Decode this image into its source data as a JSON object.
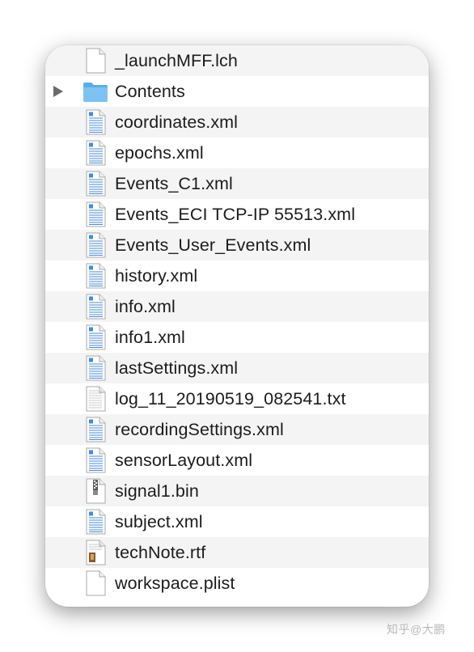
{
  "finder": {
    "files": [
      {
        "name": "_launchMFF.lch",
        "icon": "blank-document-icon",
        "kind": "blank"
      },
      {
        "name": "Contents",
        "icon": "folder-icon",
        "kind": "folder",
        "expandable": true
      },
      {
        "name": "coordinates.xml",
        "icon": "xml-document-icon",
        "kind": "xml"
      },
      {
        "name": "epochs.xml",
        "icon": "xml-document-icon",
        "kind": "xml"
      },
      {
        "name": "Events_C1.xml",
        "icon": "xml-document-icon",
        "kind": "xml"
      },
      {
        "name": "Events_ECI TCP-IP 55513.xml",
        "icon": "xml-document-icon",
        "kind": "xml"
      },
      {
        "name": "Events_User_Events.xml",
        "icon": "xml-document-icon",
        "kind": "xml"
      },
      {
        "name": "history.xml",
        "icon": "xml-document-icon",
        "kind": "xml"
      },
      {
        "name": "info.xml",
        "icon": "xml-document-icon",
        "kind": "xml"
      },
      {
        "name": "info1.xml",
        "icon": "xml-document-icon",
        "kind": "xml"
      },
      {
        "name": "lastSettings.xml",
        "icon": "xml-document-icon",
        "kind": "xml"
      },
      {
        "name": "log_11_20190519_082541.txt",
        "icon": "text-document-icon",
        "kind": "text"
      },
      {
        "name": "recordingSettings.xml",
        "icon": "xml-document-icon",
        "kind": "xml"
      },
      {
        "name": "sensorLayout.xml",
        "icon": "xml-document-icon",
        "kind": "xml"
      },
      {
        "name": "signal1.bin",
        "icon": "binary-archive-icon",
        "kind": "bin"
      },
      {
        "name": "subject.xml",
        "icon": "xml-document-icon",
        "kind": "xml"
      },
      {
        "name": "techNote.rtf",
        "icon": "rtf-document-icon",
        "kind": "rtf"
      },
      {
        "name": "workspace.plist",
        "icon": "blank-document-icon",
        "kind": "blank"
      }
    ]
  },
  "watermark": "知乎@大鹏"
}
